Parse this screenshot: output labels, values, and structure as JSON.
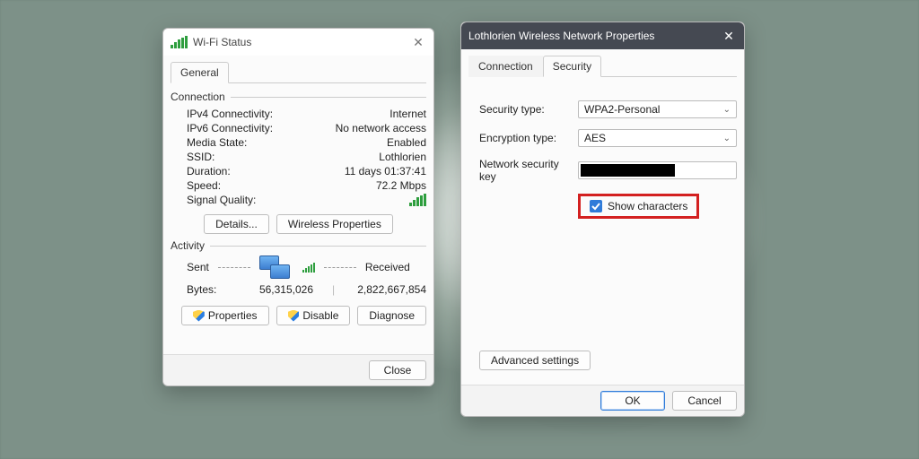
{
  "status_window": {
    "title": "Wi-Fi Status",
    "tabs": {
      "general": "General"
    },
    "connection_header": "Connection",
    "rows": {
      "ipv4_label": "IPv4 Connectivity:",
      "ipv4_value": "Internet",
      "ipv6_label": "IPv6 Connectivity:",
      "ipv6_value": "No network access",
      "media_label": "Media State:",
      "media_value": "Enabled",
      "ssid_label": "SSID:",
      "ssid_value": "Lothlorien",
      "dur_label": "Duration:",
      "dur_value": "11 days 01:37:41",
      "speed_label": "Speed:",
      "speed_value": "72.2 Mbps",
      "signal_label": "Signal Quality:"
    },
    "buttons": {
      "details": "Details...",
      "wireless_props": "Wireless Properties"
    },
    "activity_header": "Activity",
    "activity": {
      "sent_label": "Sent",
      "received_label": "Received",
      "bytes_label": "Bytes:",
      "sent_bytes": "56,315,026",
      "received_bytes": "2,822,667,854"
    },
    "bottom_buttons": {
      "properties": "Properties",
      "disable": "Disable",
      "diagnose": "Diagnose"
    },
    "close_label": "Close"
  },
  "props_window": {
    "title": "Lothlorien Wireless Network Properties",
    "tabs": {
      "connection": "Connection",
      "security": "Security"
    },
    "fields": {
      "security_type_label": "Security type:",
      "security_type_value": "WPA2-Personal",
      "encryption_type_label": "Encryption type:",
      "encryption_type_value": "AES",
      "key_label": "Network security key"
    },
    "show_characters_label": "Show characters",
    "show_characters_checked": true,
    "advanced_btn": "Advanced settings",
    "ok_label": "OK",
    "cancel_label": "Cancel"
  }
}
